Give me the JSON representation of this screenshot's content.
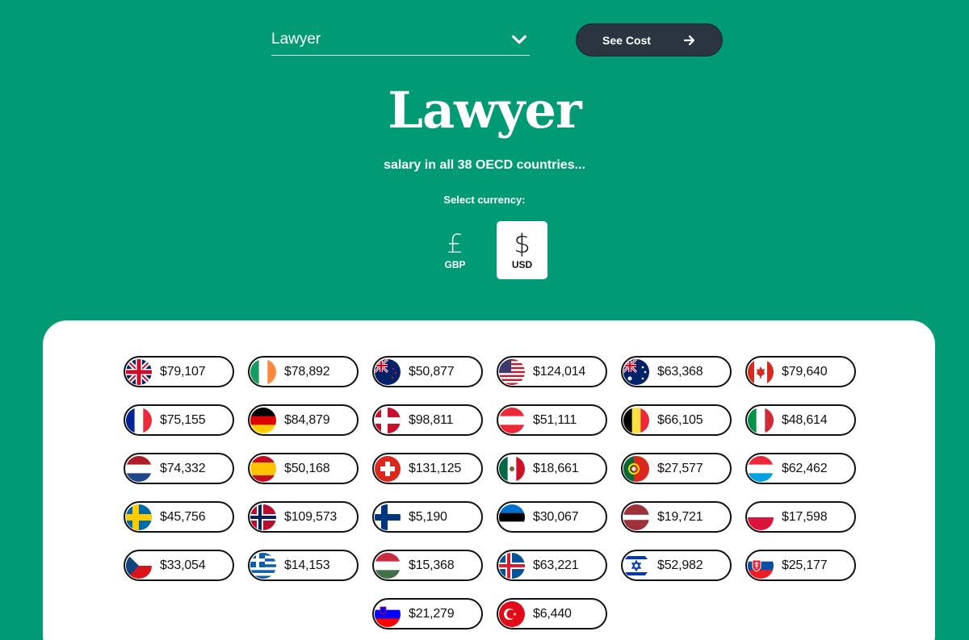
{
  "header": {
    "occupation_select": {
      "value": "Lawyer",
      "icon": "chevron-down-icon"
    },
    "see_cost_button": {
      "label": "See Cost",
      "icon": "arrow-right-icon"
    },
    "title": "Lawyer",
    "subtitle": "salary in all 38 OECD countries...",
    "currency_label": "Select currency:",
    "currencies": [
      {
        "symbol": "£",
        "code": "GBP",
        "selected": false
      },
      {
        "symbol": "$",
        "code": "USD",
        "selected": true
      }
    ]
  },
  "colors": {
    "background": "#009a74",
    "button": "#2a3541",
    "panel": "#ffffff"
  },
  "salaries": [
    [
      {
        "flag": "gb",
        "value": "$79,107"
      },
      {
        "flag": "ie",
        "value": "$78,892"
      },
      {
        "flag": "nz",
        "value": "$50,877"
      },
      {
        "flag": "us",
        "value": "$124,014"
      },
      {
        "flag": "au",
        "value": "$63,368"
      },
      {
        "flag": "ca",
        "value": "$79,640"
      }
    ],
    [
      {
        "flag": "fr",
        "value": "$75,155"
      },
      {
        "flag": "de",
        "value": "$84,879"
      },
      {
        "flag": "dk",
        "value": "$98,811"
      },
      {
        "flag": "at",
        "value": "$51,111"
      },
      {
        "flag": "be",
        "value": "$66,105"
      },
      {
        "flag": "it",
        "value": "$48,614"
      }
    ],
    [
      {
        "flag": "nl",
        "value": "$74,332"
      },
      {
        "flag": "es",
        "value": "$50,168"
      },
      {
        "flag": "ch",
        "value": "$131,125"
      },
      {
        "flag": "mx",
        "value": "$18,661"
      },
      {
        "flag": "pt",
        "value": "$27,577"
      },
      {
        "flag": "lu",
        "value": "$62,462"
      }
    ],
    [
      {
        "flag": "se",
        "value": "$45,756"
      },
      {
        "flag": "no",
        "value": "$109,573"
      },
      {
        "flag": "fi",
        "value": "$5,190"
      },
      {
        "flag": "ee",
        "value": "$30,067"
      },
      {
        "flag": "lv",
        "value": "$19,721"
      },
      {
        "flag": "pl",
        "value": "$17,598"
      }
    ],
    [
      {
        "flag": "cz",
        "value": "$33,054"
      },
      {
        "flag": "gr",
        "value": "$14,153"
      },
      {
        "flag": "hu",
        "value": "$15,368"
      },
      {
        "flag": "is",
        "value": "$63,221"
      },
      {
        "flag": "il",
        "value": "$52,982"
      },
      {
        "flag": "sk",
        "value": "$25,177"
      }
    ],
    [
      {
        "flag": "si",
        "value": "$21,279"
      },
      {
        "flag": "tr",
        "value": "$6,440"
      }
    ]
  ]
}
